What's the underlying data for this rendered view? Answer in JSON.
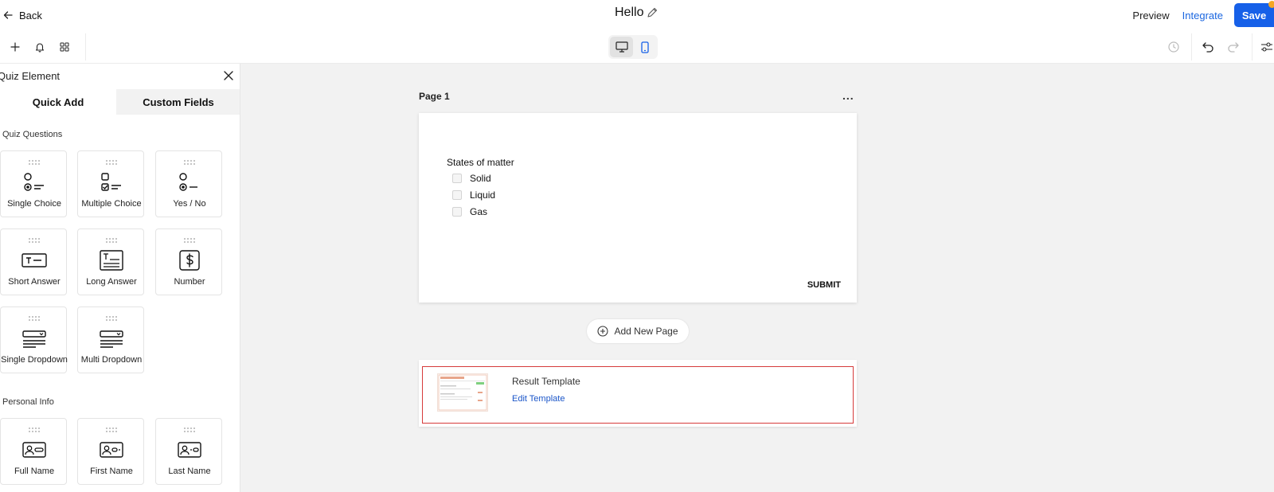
{
  "header": {
    "back_label": "Back",
    "title": "Hello",
    "preview_label": "Preview",
    "integrate_label": "Integrate",
    "save_label": "Save",
    "accent_color": "#1660e8"
  },
  "toolbar": {
    "left_icons": [
      "plus-icon",
      "bell-icon",
      "grid-icon"
    ],
    "device_modes": [
      "desktop",
      "mobile"
    ],
    "active_device": "mobile",
    "right_icons": [
      "history-icon",
      "undo-icon",
      "redo-icon",
      "settings-sliders-icon"
    ]
  },
  "sidebar": {
    "title": "Quiz Element",
    "tabs": [
      {
        "label": "Quick Add",
        "active": true
      },
      {
        "label": "Custom Fields",
        "active": false
      }
    ],
    "sections": [
      {
        "label": "Quiz Questions",
        "items": [
          {
            "label": "Single Choice",
            "icon": "single-choice-icon"
          },
          {
            "label": "Multiple Choice",
            "icon": "multiple-choice-icon"
          },
          {
            "label": "Yes / No",
            "icon": "yes-no-icon"
          },
          {
            "label": "Short Answer",
            "icon": "short-answer-icon"
          },
          {
            "label": "Long Answer",
            "icon": "long-answer-icon"
          },
          {
            "label": "Number",
            "icon": "number-icon"
          },
          {
            "label": "Single Dropdown",
            "icon": "single-dropdown-icon"
          },
          {
            "label": "Multi Dropdown",
            "icon": "multi-dropdown-icon"
          }
        ]
      },
      {
        "label": "Personal Info",
        "items": [
          {
            "label": "Full Name",
            "icon": "full-name-icon"
          },
          {
            "label": "First Name",
            "icon": "first-name-icon"
          },
          {
            "label": "Last Name",
            "icon": "last-name-icon"
          }
        ]
      }
    ]
  },
  "canvas": {
    "page_label": "Page 1",
    "menu_label": "...",
    "question": "States of matter",
    "options": [
      "Solid",
      "Liquid",
      "Gas"
    ],
    "submit_label": "SUBMIT",
    "add_page_label": "Add New Page",
    "result": {
      "title": "Result Template",
      "edit_label": "Edit Template",
      "highlight_color": "#d63a3a"
    }
  }
}
